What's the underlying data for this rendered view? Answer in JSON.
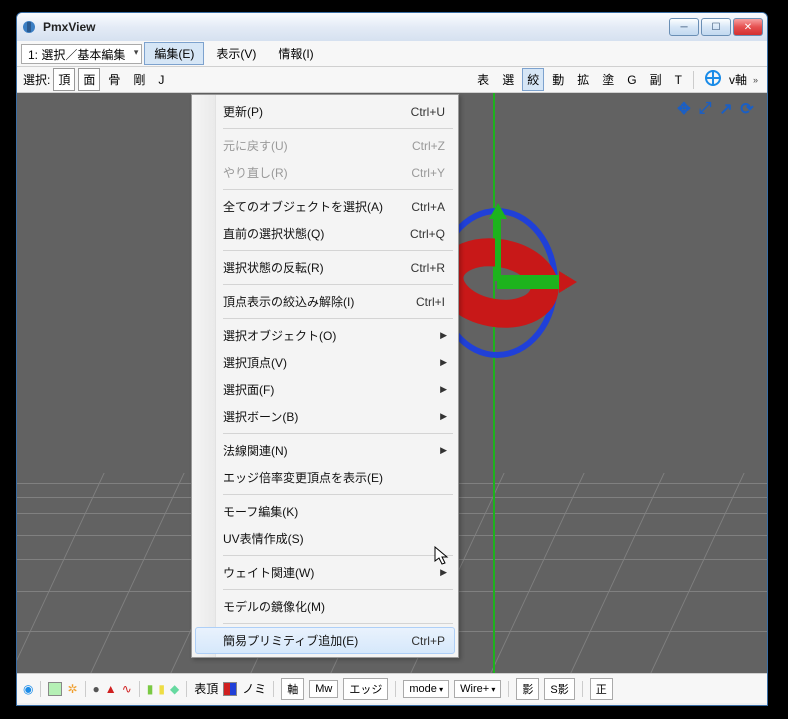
{
  "window": {
    "title": "PmxView"
  },
  "menubar": {
    "mode": "1: 選択／基本編集",
    "items": [
      {
        "label": "編集(E)",
        "active": true
      },
      {
        "label": "表示(V)",
        "active": false
      },
      {
        "label": "情報(I)",
        "active": false
      }
    ]
  },
  "toolbar": {
    "select_label": "選択:",
    "btn_vertex": "頂",
    "btn_face": "面",
    "btn_bone": "骨",
    "btn_rigid": "剛",
    "btn_J": "J",
    "right_buttons": [
      "表",
      "選",
      "絞",
      "動",
      "拡",
      "塗",
      "G",
      "副",
      "T"
    ],
    "right_active_index": 2,
    "axis_label": "v軸"
  },
  "dropdown": {
    "items": [
      {
        "label": "更新(P)",
        "shortcut": "Ctrl+U",
        "type": "item"
      },
      {
        "type": "sep"
      },
      {
        "label": "元に戻す(U)",
        "shortcut": "Ctrl+Z",
        "type": "item",
        "disabled": true
      },
      {
        "label": "やり直し(R)",
        "shortcut": "Ctrl+Y",
        "type": "item",
        "disabled": true
      },
      {
        "type": "sep"
      },
      {
        "label": "全てのオブジェクトを選択(A)",
        "shortcut": "Ctrl+A",
        "type": "item"
      },
      {
        "label": "直前の選択状態(Q)",
        "shortcut": "Ctrl+Q",
        "type": "item"
      },
      {
        "type": "sep"
      },
      {
        "label": "選択状態の反転(R)",
        "shortcut": "Ctrl+R",
        "type": "item"
      },
      {
        "type": "sep"
      },
      {
        "label": "頂点表示の絞込み解除(I)",
        "shortcut": "Ctrl+I",
        "type": "item"
      },
      {
        "type": "sep"
      },
      {
        "label": "選択オブジェクト(O)",
        "type": "submenu"
      },
      {
        "label": "選択頂点(V)",
        "type": "submenu"
      },
      {
        "label": "選択面(F)",
        "type": "submenu"
      },
      {
        "label": "選択ボーン(B)",
        "type": "submenu"
      },
      {
        "type": "sep"
      },
      {
        "label": "法線関連(N)",
        "type": "submenu"
      },
      {
        "label": "エッジ倍率変更頂点を表示(E)",
        "type": "item"
      },
      {
        "type": "sep"
      },
      {
        "label": "モーフ編集(K)",
        "type": "item"
      },
      {
        "label": "UV表情作成(S)",
        "type": "item"
      },
      {
        "type": "sep"
      },
      {
        "label": "ウェイト関連(W)",
        "type": "submenu"
      },
      {
        "type": "sep"
      },
      {
        "label": "モデルの鏡像化(M)",
        "type": "item"
      },
      {
        "type": "sep"
      },
      {
        "label": "簡易プリミティブ追加(E)",
        "shortcut": "Ctrl+P",
        "type": "item",
        "hover": true
      }
    ]
  },
  "statusbar": {
    "label_vertex": "表頂",
    "label_nomi": "ノミ",
    "btn_axis": "軸",
    "btn_mw": "Mw",
    "btn_edge": "エッジ",
    "btn_mode": "mode",
    "btn_wire": "Wire+",
    "btn_shadow": "影",
    "btn_sshadow": "S影",
    "btn_ortho": "正"
  }
}
